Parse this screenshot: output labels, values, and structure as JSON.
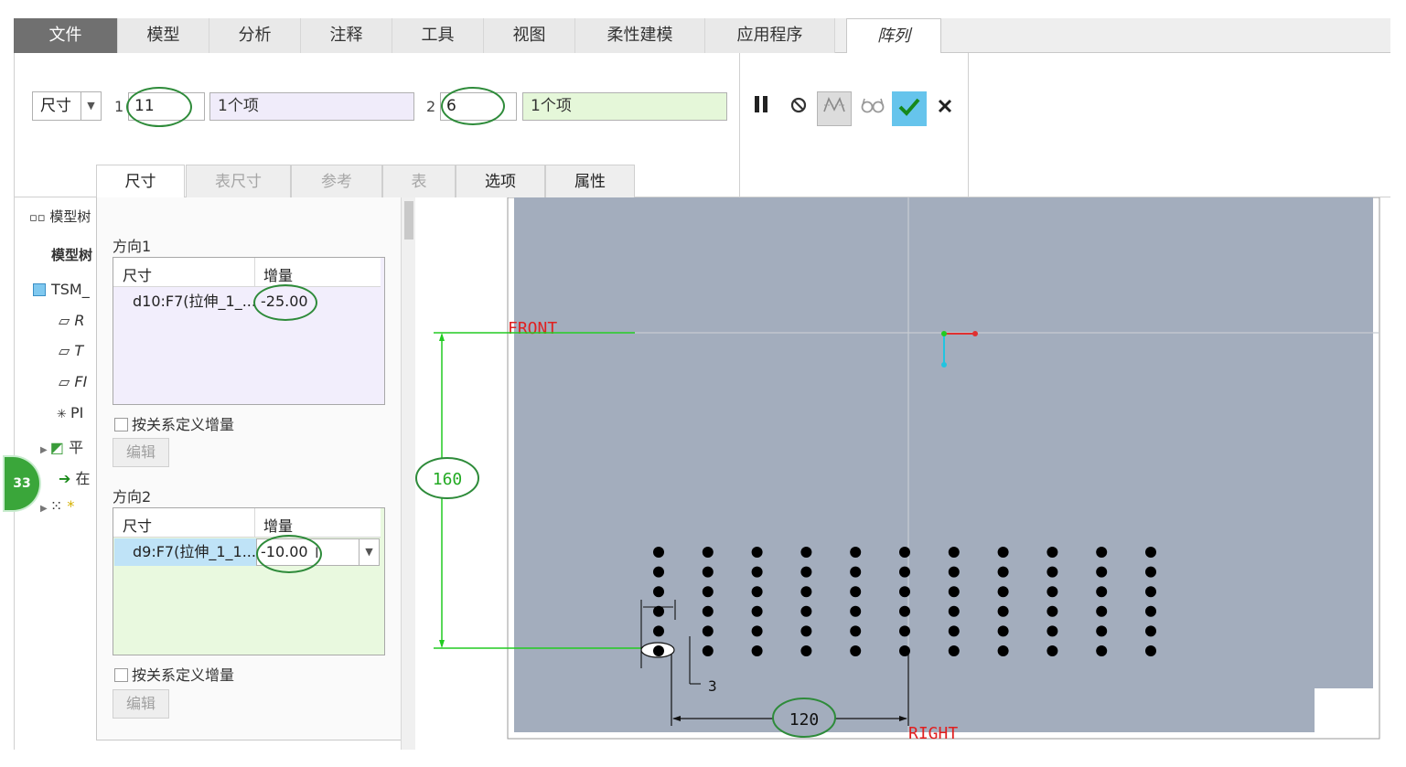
{
  "tabs": {
    "file": "文件",
    "model": "模型",
    "analysis": "分析",
    "annotate": "注释",
    "tools": "工具",
    "view": "视图",
    "flexible": "柔性建模",
    "apps": "应用程序",
    "pattern": "阵列"
  },
  "ribbon": {
    "pattern_type": "尺寸",
    "dir1_label": "1",
    "dir1_count": "11",
    "dir1_items": "1个项",
    "dir2_label": "2",
    "dir2_count": "6",
    "dir2_items": "1个项",
    "pause_icon": "pause-icon",
    "no_preview_icon": "no-preview-icon",
    "preview_icon": "geometry-preview-icon",
    "glasses_icon": "glasses-icon",
    "ok_icon": "checkmark-icon",
    "cancel_icon": "close-icon"
  },
  "subtabs": {
    "dimensions": "尺寸",
    "table_dims": "表尺寸",
    "references": "参考",
    "tables": "表",
    "options": "选项",
    "properties": "属性"
  },
  "tree": {
    "header": "模型树",
    "subheader": "模型树",
    "root": "TSM_",
    "rows": [
      "R",
      "T",
      "FI",
      "PI",
      "平",
      "在",
      "*"
    ],
    "badge": "33"
  },
  "panel": {
    "dir1_title": "方向1",
    "dir2_title": "方向2",
    "col_dim": "尺寸",
    "col_inc": "增量",
    "dir1_dim": "d10:F7(拉伸_1_...",
    "dir1_inc": "-25.00",
    "dir2_dim": "d9:F7(拉伸_1_1...",
    "dir2_inc": "-10.00",
    "relation_label": "按关系定义增量",
    "edit_label": "编辑"
  },
  "graphics": {
    "front_label": "FRONT",
    "right_label": "RIGHT",
    "dim_160": "160",
    "dim_120": "120",
    "dim_3": "3",
    "hole_columns": 11,
    "hole_rows": 6
  },
  "colors": {
    "model_fill": "#a3adbd",
    "datum_label": "#e02020",
    "dimension_line": "#22cc22",
    "highlight_oval": "#2e8b3a",
    "ok_button": "#66c4ec"
  }
}
